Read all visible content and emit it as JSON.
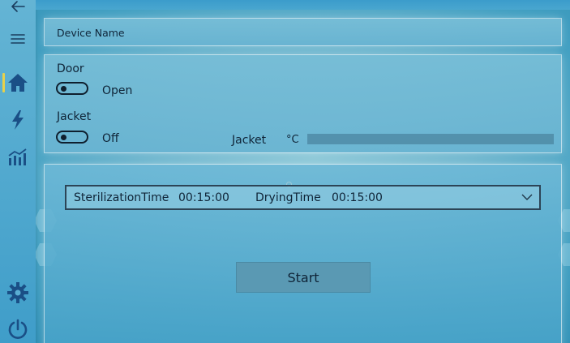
{
  "top_strip": {
    "glyph_text": ""
  },
  "nav": {
    "items": [
      {
        "name": "back",
        "icon": "back-arrow-icon"
      },
      {
        "name": "menu",
        "icon": "hamburger-icon"
      },
      {
        "name": "home",
        "icon": "home-icon",
        "active": true
      },
      {
        "name": "power-status",
        "icon": "lightning-icon"
      },
      {
        "name": "statistics",
        "icon": "chart-icon"
      },
      {
        "name": "settings",
        "icon": "gear-icon"
      },
      {
        "name": "power",
        "icon": "power-icon"
      }
    ],
    "accent_color": "#e7d14a",
    "icon_color": "#1a4f86"
  },
  "device": {
    "name_label": "Device Name"
  },
  "status": {
    "door": {
      "title": "Door",
      "state": "Open"
    },
    "jacket": {
      "title": "Jacket",
      "state": "Off"
    },
    "jacket_temp": {
      "label": "Jacket",
      "unit": "°C"
    }
  },
  "program": {
    "sterilization_label": "SterilizationTime",
    "sterilization_value": "00:15:00",
    "drying_label": "DryingTime",
    "drying_value": "00:15:00"
  },
  "actions": {
    "start_label": "Start"
  }
}
